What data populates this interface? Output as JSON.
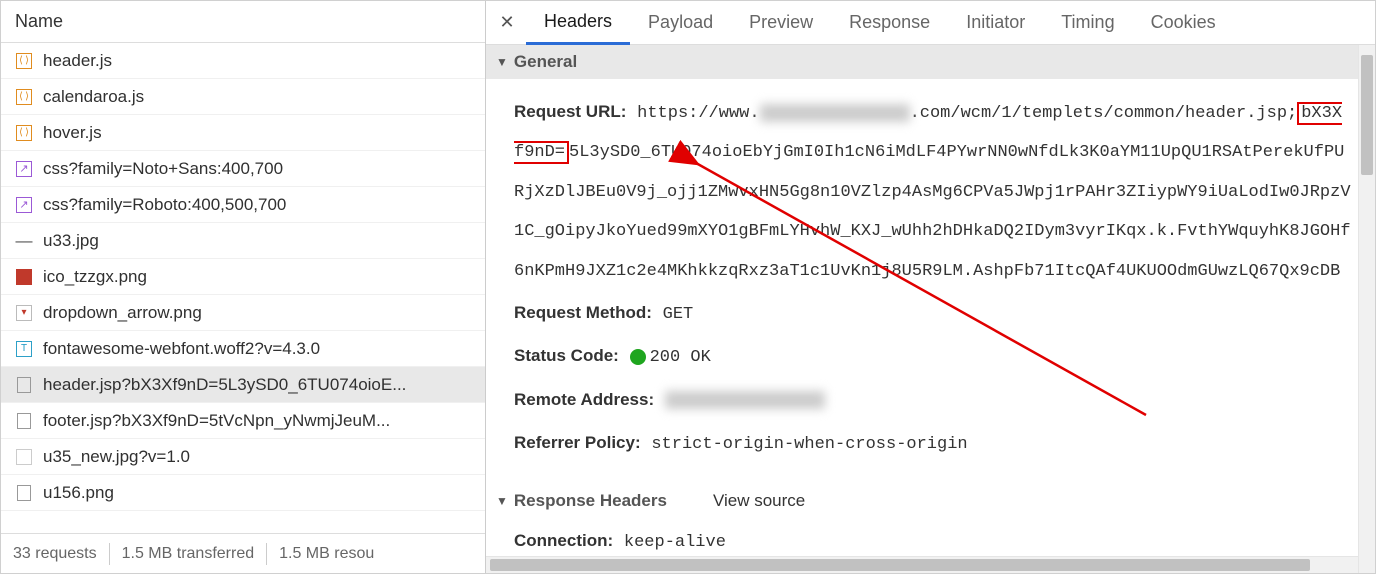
{
  "left": {
    "header": "Name",
    "files": [
      {
        "icon": "js",
        "name": "header.js"
      },
      {
        "icon": "js",
        "name": "calendaroa.js"
      },
      {
        "icon": "js",
        "name": "hover.js"
      },
      {
        "icon": "css",
        "name": "css?family=Noto+Sans:400,700"
      },
      {
        "icon": "css",
        "name": "css?family=Roboto:400,500,700"
      },
      {
        "icon": "img-dash",
        "name": "u33.jpg"
      },
      {
        "icon": "png-red",
        "name": "ico_tzzgx.png"
      },
      {
        "icon": "png-white",
        "name": "dropdown_arrow.png"
      },
      {
        "icon": "font",
        "name": "fontawesome-webfont.woff2?v=4.3.0"
      },
      {
        "icon": "doc",
        "name": "header.jsp?bX3Xf9nD=5L3ySD0_6TU074oioE...",
        "selected": true
      },
      {
        "icon": "doc",
        "name": "footer.jsp?bX3Xf9nD=5tVcNpn_yNwmjJeuM..."
      },
      {
        "icon": "img2",
        "name": "u35_new.jpg?v=1.0"
      },
      {
        "icon": "doc",
        "name": "u156.png"
      }
    ],
    "footer": {
      "requests": "33 requests",
      "transferred": "1.5 MB transferred",
      "resources": "1.5 MB resou"
    }
  },
  "tabs": [
    "Headers",
    "Payload",
    "Preview",
    "Response",
    "Initiator",
    "Timing",
    "Cookies"
  ],
  "active_tab": 0,
  "general": {
    "title": "General",
    "request_url_label": "Request URL:",
    "url_prefix": "https://www.",
    "url_mid": ".com/wcm/1/templets/common/header.jsp;",
    "url_boxed": "bX3Xf9nD=",
    "url_rest": "5L3ySD0_6TU074oioEbYjGmI0Ih1cN6iMdLF4PYwrNN0wNfdLk3K0aYM11UpQU1RSAtPerekUfPURjXzDlJBEu0V9j_ojj1ZMwvxHN5Gg8n10VZlzp4AsMg6CPVa5JWpj1rPAHr3ZIiypWY9iUaLodIw0JRpzV1C_gOipyJkoYued99mXYO1gBFmLYHvhW_KXJ_wUhh2hDHkaDQ2IDym3vyrIKqx.k.FvthYWquyhK8JGOHf6nKPmH9JXZ1c2e4MKhkkzqRxz3aT1c1UvKn1j8U5R9LM.AshpFb71ItcQAf4UKUOOdmGUwzLQ67Qx9cDB",
    "method_label": "Request Method:",
    "method": "GET",
    "status_label": "Status Code:",
    "status": "200 OK",
    "remote_label": "Remote Address:",
    "referrer_label": "Referrer Policy:",
    "referrer": "strict-origin-when-cross-origin"
  },
  "response_headers": {
    "title": "Response Headers",
    "view_source": "View source",
    "connection_label": "Connection:",
    "connection": "keep-alive"
  }
}
